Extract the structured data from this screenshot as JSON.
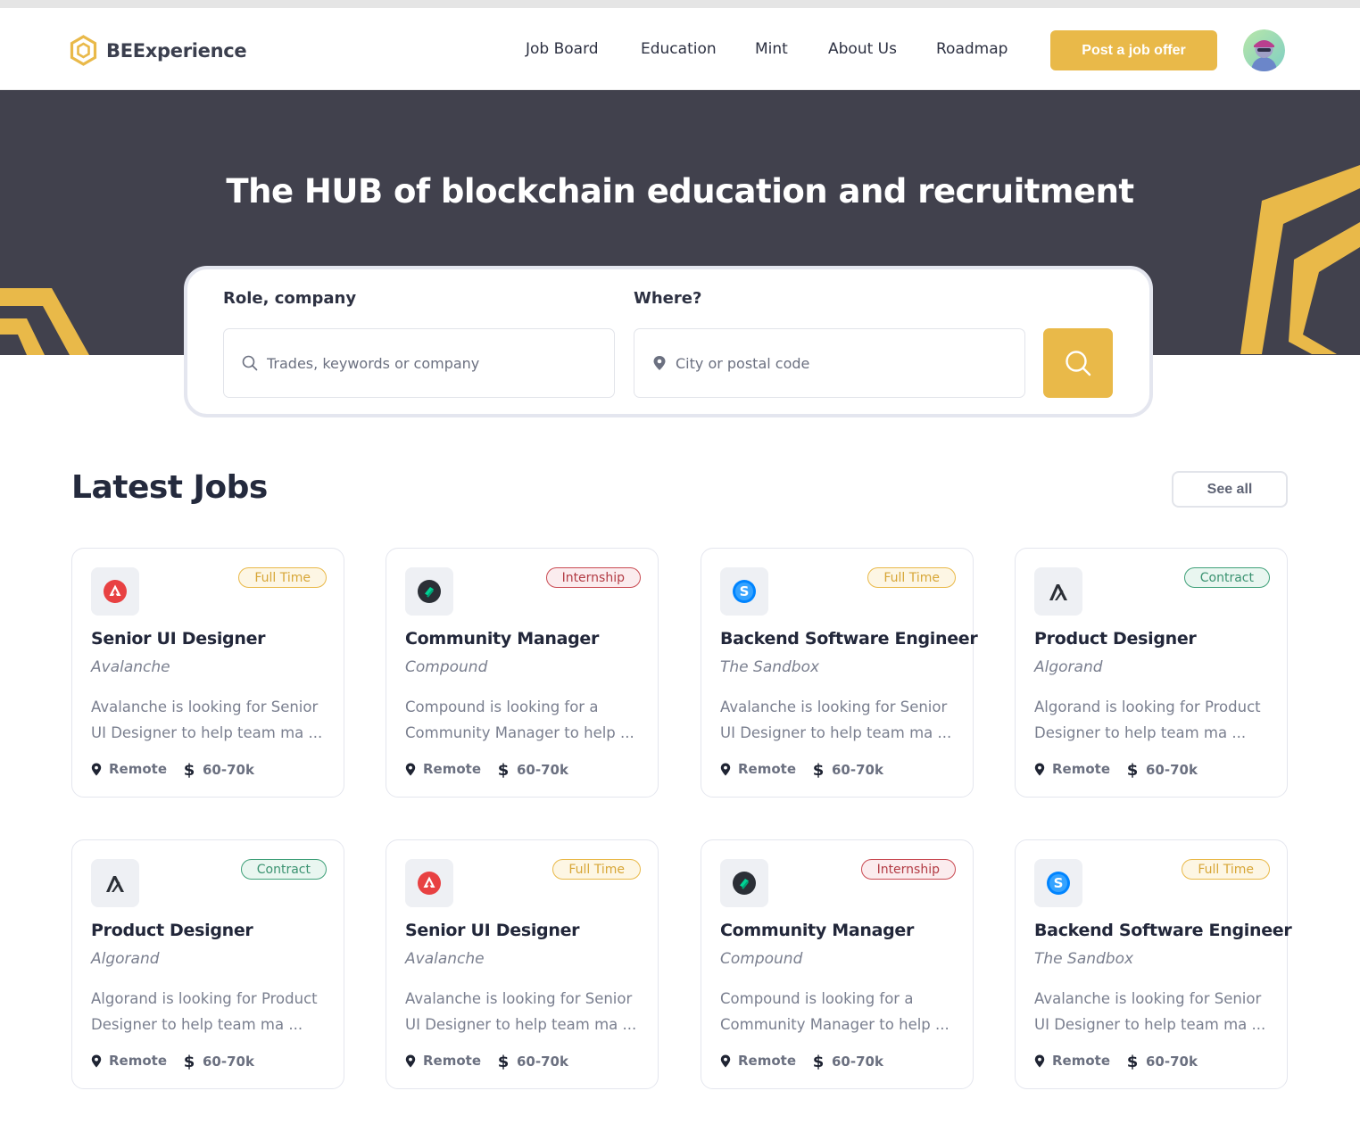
{
  "header": {
    "logo_text": "BEExperience",
    "nav": [
      "Job Board",
      "Education",
      "Mint",
      "About Us",
      "Roadmap"
    ],
    "post_button": "Post a job offer"
  },
  "hero": {
    "title": "The HUB of blockchain education and recruitment"
  },
  "search": {
    "role_label": "Role, company",
    "role_placeholder": "Trades, keywords or company",
    "where_label": "Where?",
    "where_placeholder": "City or postal code"
  },
  "jobs_section": {
    "title": "Latest Jobs",
    "see_all": "See all"
  },
  "colors": {
    "accent": "#e9b949",
    "hero_bg": "#41414d",
    "fulltime": "#e9b949",
    "internship": "#c94a52",
    "contract": "#3fa079"
  },
  "jobs": [
    {
      "title": "Senior UI Designer",
      "company": "Avalanche",
      "tag": "Full Time",
      "tag_type": "fulltime",
      "logo": "avalanche-logo-icon",
      "desc": "Avalanche is looking for Senior UI Designer to help team ma ...",
      "location": "Remote",
      "salary": "60-70k"
    },
    {
      "title": "Community Manager",
      "company": "Compound",
      "tag": "Internship",
      "tag_type": "internship",
      "logo": "compound-logo-icon",
      "desc": "Compound is looking for a Community Manager to help ...",
      "location": "Remote",
      "salary": "60-70k"
    },
    {
      "title": "Backend Software Engineer",
      "company": "The Sandbox",
      "tag": "Full Time",
      "tag_type": "fulltime",
      "logo": "sandbox-logo-icon",
      "desc": "Avalanche is looking for Senior UI Designer to help team ma ...",
      "location": "Remote",
      "salary": "60-70k"
    },
    {
      "title": "Product Designer",
      "company": "Algorand",
      "tag": "Contract",
      "tag_type": "contract",
      "logo": "algorand-logo-icon",
      "desc": "Algorand is looking for Product Designer to help team ma ...",
      "location": "Remote",
      "salary": "60-70k"
    },
    {
      "title": "Product Designer",
      "company": "Algorand",
      "tag": "Contract",
      "tag_type": "contract",
      "logo": "algorand-logo-icon",
      "desc": "Algorand is looking for Product Designer to help team ma ...",
      "location": "Remote",
      "salary": "60-70k"
    },
    {
      "title": "Senior UI Designer",
      "company": "Avalanche",
      "tag": "Full Time",
      "tag_type": "fulltime",
      "logo": "avalanche-logo-icon",
      "desc": "Avalanche is looking for Senior UI Designer to help team ma ...",
      "location": "Remote",
      "salary": "60-70k"
    },
    {
      "title": "Community Manager",
      "company": "Compound",
      "tag": "Internship",
      "tag_type": "internship",
      "logo": "compound-logo-icon",
      "desc": "Compound is looking for a Community Manager to help ...",
      "location": "Remote",
      "salary": "60-70k"
    },
    {
      "title": "Backend Software Engineer",
      "company": "The Sandbox",
      "tag": "Full Time",
      "tag_type": "fulltime",
      "logo": "sandbox-logo-icon",
      "desc": "Avalanche is looking for Senior UI Designer to help team ma ...",
      "location": "Remote",
      "salary": "60-70k"
    }
  ]
}
